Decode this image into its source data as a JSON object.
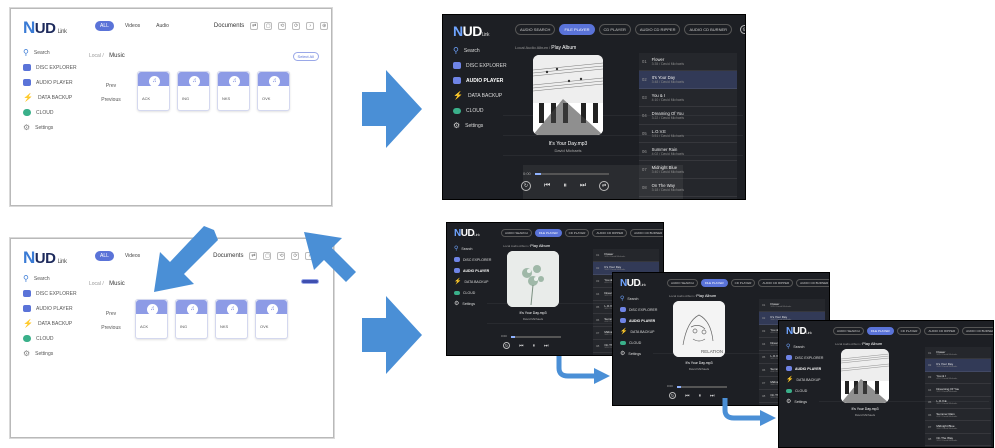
{
  "light_app": {
    "logo": "UD",
    "logo_sub": "Link",
    "tabs": [
      "ALL",
      "Videos",
      "Audio"
    ],
    "docs": "Documents",
    "sidebar": [
      "Search",
      "DISC EXPLORER",
      "AUDIO PLAYER",
      "DATA BACKUP",
      "CLOUD",
      "Settings"
    ],
    "path_prefix": "Local",
    "path_folder": "Music",
    "select": "Prev",
    "select2": "Previous",
    "folders": [
      "ACK",
      "ING",
      "NKS",
      "OVK"
    ],
    "corner_button": "Select All"
  },
  "dark_app": {
    "logo": "UD",
    "logo_sub": "Link",
    "tabs": [
      "AUDIO SEARCH",
      "FILE PLAYER",
      "CD PLAYER",
      "AUDIO CD RIPPER",
      "AUDIO CD BURNER"
    ],
    "sidebar": [
      "Search",
      "DISC EXPLORER",
      "AUDIO PLAYER",
      "DATA BACKUP",
      "CLOUD",
      "Settings"
    ],
    "breadcrumb_prefix": "Local Audio Album",
    "breadcrumb": "Play Album",
    "track_title": "It's Your Day.mp3",
    "track_artist": "David Michaels",
    "time_start": "0:00",
    "progress": 0.08,
    "playlist": [
      {
        "num": "01",
        "title": "Flower",
        "sub": "3:35 / David Michaels"
      },
      {
        "num": "02",
        "title": "It's Your Day",
        "sub": "3:48 / David Michaels"
      },
      {
        "num": "03",
        "title": "You & I",
        "sub": "4:10 / David Michaels"
      },
      {
        "num": "04",
        "title": "Dreaming Of You",
        "sub": "3:22 / David Michaels"
      },
      {
        "num": "05",
        "title": "L.O.V.E",
        "sub": "3:51 / David Michaels"
      },
      {
        "num": "06",
        "title": "Summer Rain",
        "sub": "4:02 / David Michaels"
      },
      {
        "num": "07",
        "title": "Midnight Blue",
        "sub": "3:40 / David Michaels"
      },
      {
        "num": "08",
        "title": "On The Way",
        "sub": "3:18 / David Michaels"
      }
    ],
    "art_text": "RELATION"
  },
  "colors": {
    "accent": "#5a73d8",
    "arrow": "#4a8fd6",
    "dark_bg": "#1d1f24"
  }
}
